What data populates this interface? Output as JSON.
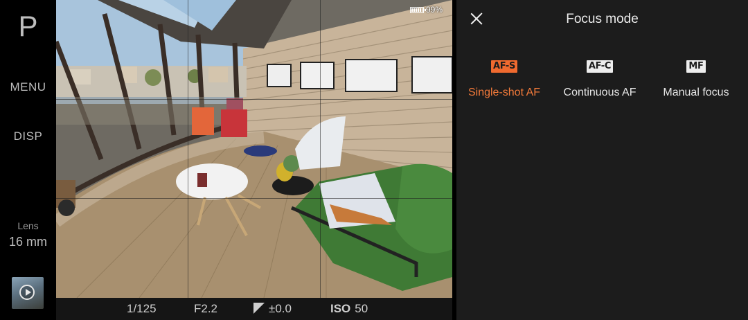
{
  "left_rail": {
    "mode": "P",
    "menu_label": "MENU",
    "disp_label": "DISP",
    "lens_label": "Lens",
    "lens_value": "16 mm"
  },
  "viewfinder": {
    "battery_percent": "99%"
  },
  "status_bar": {
    "shutter": "1/125",
    "aperture": "F2.2",
    "exposure_comp": "±0.0",
    "iso_label": "ISO",
    "iso_value": "50"
  },
  "focus_panel": {
    "title": "Focus mode",
    "accent_color": "#f06a2f",
    "options": [
      {
        "badge": "AF-S",
        "label": "Single-shot AF",
        "selected": true
      },
      {
        "badge": "AF-C",
        "label": "Continuous AF",
        "selected": false
      },
      {
        "badge": "MF",
        "label": "Manual focus",
        "selected": false
      }
    ]
  }
}
